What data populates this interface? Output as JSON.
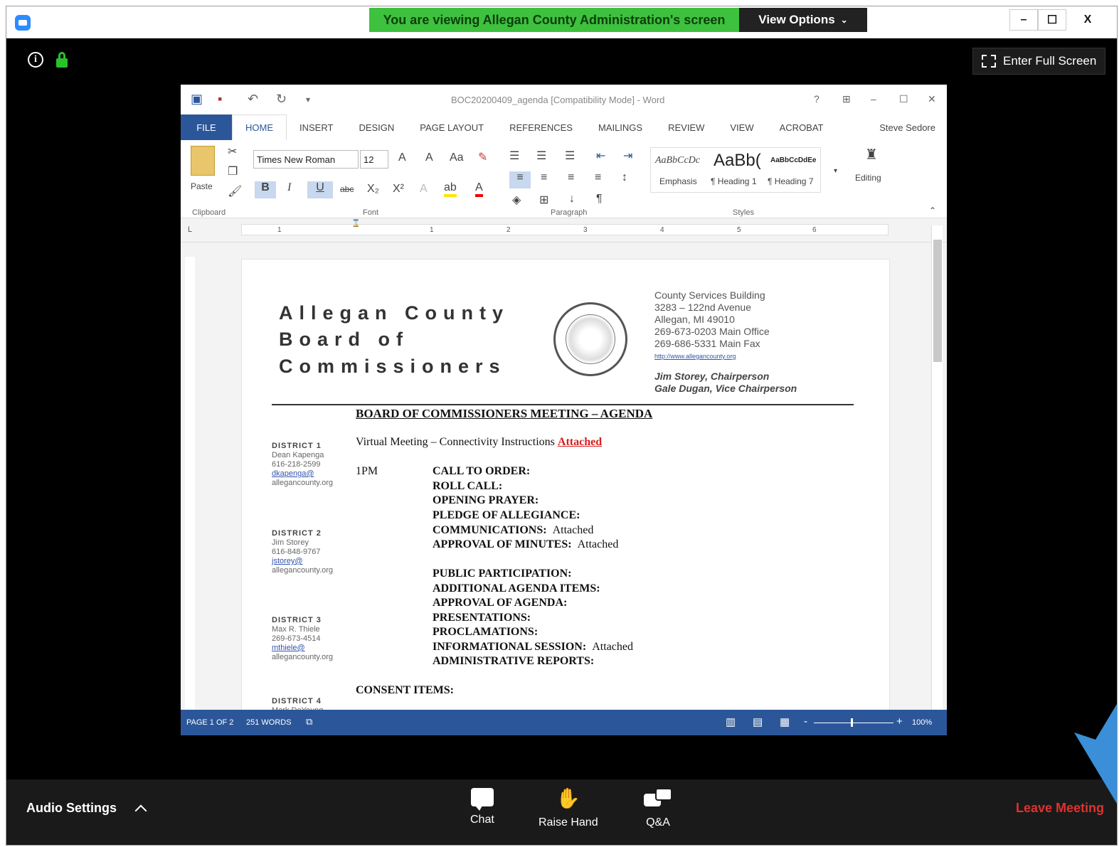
{
  "zoom": {
    "banner": "You are viewing Allegan County Administration's screen",
    "view_options": "View Options",
    "full_screen": "Enter Full Screen",
    "win_controls": [
      "–",
      "☐",
      "X"
    ],
    "bottom": {
      "audio_settings": "Audio Settings",
      "chat": "Chat",
      "raise_hand": "Raise Hand",
      "qa": "Q&A",
      "leave": "Leave Meeting"
    },
    "colors": {
      "banner": "#3ec13e",
      "leave": "#e0322f",
      "lock": "#29c22b"
    }
  },
  "word": {
    "title": "BOC20200409_agenda [Compatibility Mode] - Word",
    "tabs": [
      "FILE",
      "HOME",
      "INSERT",
      "DESIGN",
      "PAGE LAYOUT",
      "REFERENCES",
      "MAILINGS",
      "REVIEW",
      "VIEW",
      "ACROBAT"
    ],
    "user": "Steve Sedore",
    "ribbon": {
      "paste": "Paste",
      "font_name": "Times New Roman",
      "font_size": "12",
      "bold": "B",
      "italic": "I",
      "underline": "U",
      "strike": "abc",
      "sub": "X₂",
      "sup": "X²",
      "case": "Aa",
      "styles": [
        "AaBbCcDc",
        "AaBb(",
        "AaBbCcDdEe"
      ],
      "style_names": [
        "Emphasis",
        "¶ Heading 1",
        "¶ Heading 7"
      ],
      "editing": "Editing",
      "groups": [
        "Clipboard",
        "Font",
        "Paragraph",
        "Styles"
      ]
    },
    "ruler": [
      "1",
      "1",
      "2",
      "3",
      "4",
      "5",
      "6"
    ],
    "status": {
      "page": "PAGE 1 OF 2",
      "words": "251 WORDS",
      "zoom": "100%"
    }
  },
  "doc": {
    "header_lines": [
      "Allegan County",
      "Board of",
      "Commissioners"
    ],
    "address": [
      "County Services Building",
      "3283 – 122nd Avenue",
      "Allegan, MI  49010",
      "269-673-0203 Main Office",
      "269-686-5331 Main Fax"
    ],
    "url": "http://www.allegancounty.org",
    "chair": "Jim Storey, Chairperson",
    "vice": "Gale Dugan, Vice Chairperson",
    "agenda_title": "BOARD OF COMMISSIONERS MEETING – AGENDA",
    "virtual": "Virtual Meeting – Connectivity Instructions",
    "attached": "Attached",
    "time": "1PM",
    "items": [
      {
        "label": "CALL TO ORDER:",
        "note": ""
      },
      {
        "label": "ROLL CALL:",
        "note": ""
      },
      {
        "label": "OPENING PRAYER:",
        "note": ""
      },
      {
        "label": "PLEDGE OF ALLEGIANCE:",
        "note": ""
      },
      {
        "label": "COMMUNICATIONS:",
        "note": "Attached"
      },
      {
        "label": "APPROVAL OF MINUTES:",
        "note": "Attached"
      },
      {
        "label": "PUBLIC PARTICIPATION:",
        "note": ""
      },
      {
        "label": "ADDITIONAL AGENDA ITEMS:",
        "note": ""
      },
      {
        "label": "APPROVAL OF AGENDA:",
        "note": ""
      },
      {
        "label": "PRESENTATIONS:",
        "note": ""
      },
      {
        "label": "PROCLAMATIONS:",
        "note": ""
      },
      {
        "label": "INFORMATIONAL SESSION:",
        "note": "Attached"
      },
      {
        "label": "ADMINISTRATIVE REPORTS:",
        "note": ""
      }
    ],
    "consent": "CONSENT ITEMS:",
    "districts": [
      {
        "h": "DISTRICT 1",
        "name": "Dean Kapenga",
        "phone": "616-218-2599",
        "email": "dkapenga@",
        "domain": "allegancounty.org"
      },
      {
        "h": "DISTRICT 2",
        "name": "Jim Storey",
        "phone": "616-848-9767",
        "email": "jstorey@",
        "domain": "allegancounty.org"
      },
      {
        "h": "DISTRICT 3",
        "name": "Max R. Thiele",
        "phone": "269-673-4514",
        "email": "mthiele@",
        "domain": "allegancounty.org"
      },
      {
        "h": "DISTRICT 4",
        "name": "Mark DeYoung",
        "phone": "",
        "email": "",
        "domain": ""
      }
    ]
  }
}
